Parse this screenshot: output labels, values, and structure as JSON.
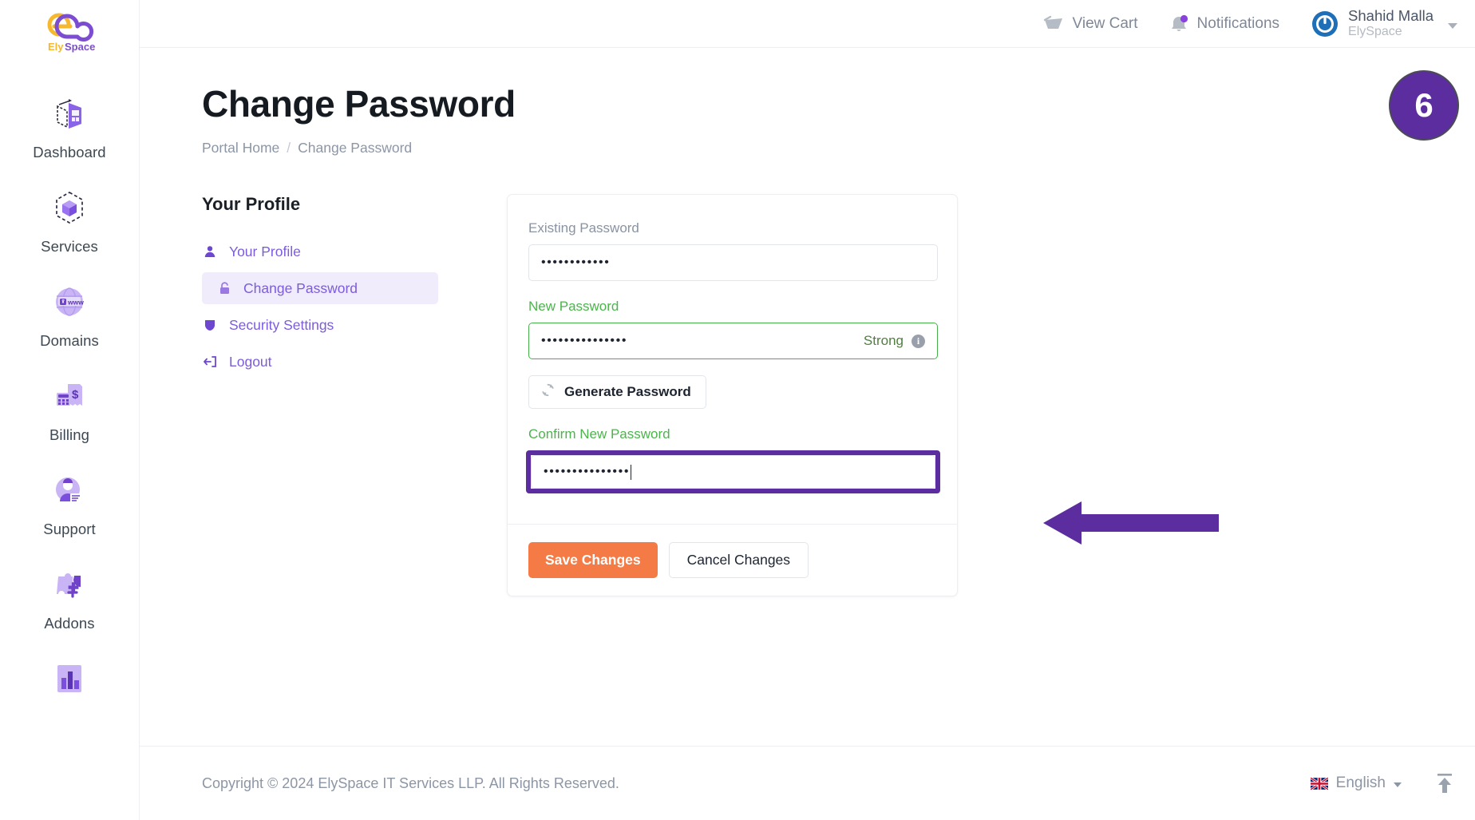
{
  "brand": {
    "name": "ElySpace",
    "name_part1": "Ely",
    "name_part2": "Space"
  },
  "sidebar": {
    "items": [
      {
        "label": "Dashboard",
        "icon": "dashboard-icon"
      },
      {
        "label": "Services",
        "icon": "services-cube-icon"
      },
      {
        "label": "Domains",
        "icon": "domains-globe-icon"
      },
      {
        "label": "Billing",
        "icon": "billing-invoice-icon"
      },
      {
        "label": "Support",
        "icon": "support-agent-icon"
      },
      {
        "label": "Addons",
        "icon": "addons-puzzle-icon"
      },
      {
        "label": "",
        "icon": "reports-chart-icon"
      }
    ]
  },
  "topbar": {
    "cart_label": "View Cart",
    "cart_icon": "cart-icon",
    "notifications_label": "Notifications",
    "notifications_icon": "bell-icon",
    "user_name": "Shahid Malla",
    "user_company": "ElySpace",
    "avatar_icon": "power-avatar-icon"
  },
  "page": {
    "title": "Change Password",
    "breadcrumb": {
      "home": "Portal Home",
      "separator": "/",
      "current": "Change Password"
    }
  },
  "profile_nav": {
    "heading": "Your Profile",
    "items": [
      {
        "label": "Your Profile",
        "icon": "user-icon",
        "active": false
      },
      {
        "label": "Change Password",
        "icon": "lock-icon",
        "active": true
      },
      {
        "label": "Security Settings",
        "icon": "shield-icon",
        "active": false
      },
      {
        "label": "Logout",
        "icon": "logout-icon",
        "active": false
      }
    ]
  },
  "form": {
    "existing_password": {
      "label": "Existing Password",
      "value": "••••••••••••",
      "placeholder": ""
    },
    "new_password": {
      "label": "New Password",
      "value": "•••••••••••••••",
      "placeholder": "",
      "strength_label": "Strong",
      "strength_info_icon": "info-icon"
    },
    "generate_button": {
      "label": "Generate Password",
      "icon": "refresh-icon"
    },
    "confirm_password": {
      "label": "Confirm New Password",
      "value": "•••••••••••••••",
      "placeholder": ""
    },
    "save_button": "Save Changes",
    "cancel_button": "Cancel Changes"
  },
  "footer": {
    "copyright": "Copyright © 2024 ElySpace IT Services LLP. All Rights Reserved.",
    "language": "English",
    "language_flag_icon": "uk-flag-icon",
    "scroll_top_icon": "arrow-up-icon"
  },
  "annotations": {
    "step_number": "6",
    "arrow_icon": "left-arrow-annotation"
  },
  "colors": {
    "brand_purple": "#7c5cdb",
    "annotation_purple": "#5b2d9e",
    "accent_orange": "#f47b45",
    "valid_green": "#47b04b",
    "muted_text": "#8d96a5"
  }
}
